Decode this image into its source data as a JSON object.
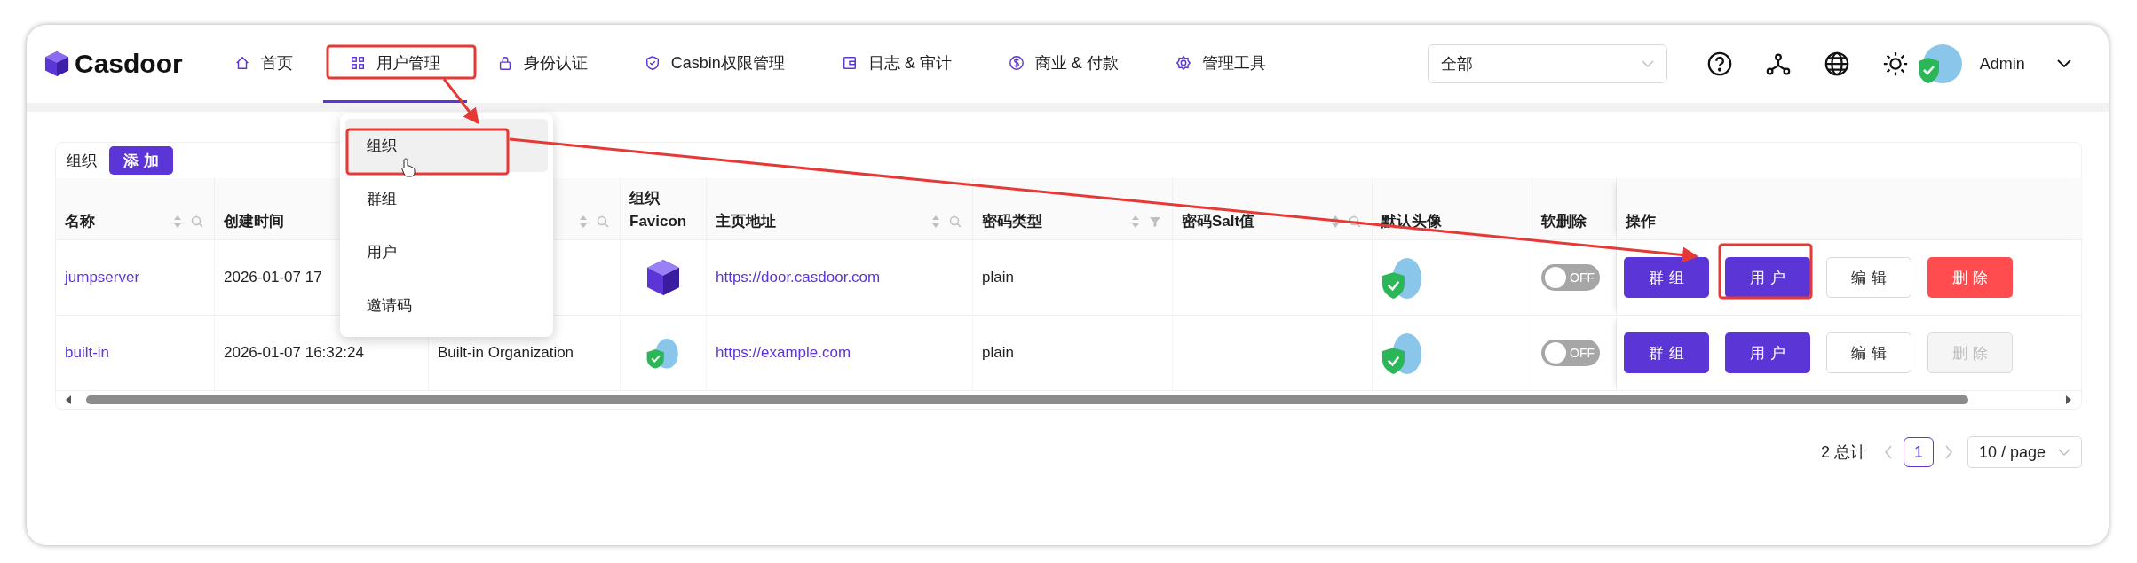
{
  "logo": {
    "text": "Casdoor"
  },
  "nav": [
    {
      "label": "首页",
      "selected": false
    },
    {
      "label": "用户管理",
      "selected": true
    },
    {
      "label": "身份认证",
      "selected": false
    },
    {
      "label": "Casbin权限管理",
      "selected": false
    },
    {
      "label": "日志 & 审计",
      "selected": false
    },
    {
      "label": "商业 & 付款",
      "selected": false
    },
    {
      "label": "管理工具",
      "selected": false
    }
  ],
  "org_select": {
    "value": "全部"
  },
  "user": {
    "name": "Admin"
  },
  "dropdown": {
    "items": [
      {
        "label": "组织",
        "selected": true
      },
      {
        "label": "群组",
        "selected": false
      },
      {
        "label": "用户",
        "selected": false
      },
      {
        "label": "邀请码",
        "selected": false
      }
    ]
  },
  "card": {
    "title": "组织",
    "add_button": "添加"
  },
  "table": {
    "columns": [
      {
        "label": "名称",
        "sortable": true,
        "searchable": true,
        "filterable": false
      },
      {
        "label": "创建时间"
      },
      {
        "sortable": true,
        "searchable": true,
        "filterable": false
      },
      {
        "label": "组织 Favicon",
        "sortable": false,
        "searchable": false,
        "filterable": false
      },
      {
        "label": "主页地址",
        "sortable": true,
        "searchable": true,
        "filterable": false
      },
      {
        "label": "密码类型",
        "sortable": true,
        "searchable": false,
        "filterable": true
      },
      {
        "label": "密码Salt值",
        "sortable": true,
        "searchable": true,
        "filterable": false
      },
      {
        "label": "默认头像",
        "sortable": false,
        "searchable": false,
        "filterable": false
      },
      {
        "label": "软删除",
        "sortable": false,
        "searchable": false,
        "filterable": false
      },
      {
        "label": "操作",
        "sortable": false,
        "searchable": false,
        "filterable": false
      }
    ],
    "rows": [
      {
        "name": "jumpserver",
        "created": "2026-01-07 17",
        "favicon": {
          "kind": "cube"
        },
        "homepage": "https://door.casdoor.com",
        "password_type": "plain",
        "soft_delete": {
          "on": false,
          "label": "OFF"
        },
        "actions": [
          {
            "label": "群组",
            "kind": "primary",
            "disabled": false
          },
          {
            "label": "用户",
            "kind": "primary",
            "disabled": false
          },
          {
            "label": "编辑",
            "kind": "default",
            "disabled": false
          },
          {
            "label": "删除",
            "kind": "danger",
            "disabled": false
          }
        ]
      },
      {
        "name": "built-in",
        "created": "2026-01-07 16:32:24",
        "display_name": "Built-in Organization",
        "favicon": {
          "kind": "mascot"
        },
        "homepage": "https://example.com",
        "password_type": "plain",
        "soft_delete": {
          "on": false,
          "label": "OFF"
        },
        "actions": [
          {
            "label": "群组",
            "kind": "primary",
            "disabled": false
          },
          {
            "label": "用户",
            "kind": "primary",
            "disabled": false
          },
          {
            "label": "编辑",
            "kind": "default",
            "disabled": false
          },
          {
            "label": "删除",
            "kind": "danger",
            "disabled": true
          }
        ]
      }
    ]
  },
  "pagination": {
    "total": "2 总计",
    "pages": [
      {
        "label": "1",
        "selected": true
      }
    ],
    "page_size": "10 / page"
  }
}
